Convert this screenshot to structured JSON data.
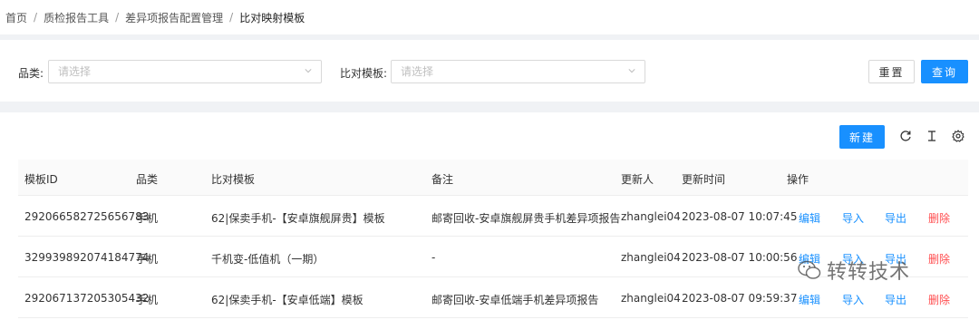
{
  "breadcrumb": [
    "首页",
    "质检报告工具",
    "差异项报告配置管理",
    "比对映射模板"
  ],
  "filters": {
    "category_label": "品类:",
    "category_placeholder": "请选择",
    "template_label": "比对模板:",
    "template_placeholder": "请选择",
    "reset_label": "重置",
    "query_label": "查询"
  },
  "toolbar": {
    "new_label": "新建",
    "icons": [
      "reload-icon",
      "column-height-icon",
      "settings-icon"
    ]
  },
  "table": {
    "columns": [
      "模板ID",
      "品类",
      "比对模板",
      "备注",
      "更新人",
      "更新时间",
      "操作"
    ],
    "rows": [
      {
        "id": "292066582725656783",
        "category": "手机",
        "template": "62|保卖手机-【安卓旗舰屏贵】模板",
        "remark": "邮寄回收-安卓旗舰屏贵手机差异项报告",
        "updater": "zhanglei04",
        "updated_at": "2023-08-07 10:07:45"
      },
      {
        "id": "329939892074184774",
        "category": "手机",
        "template": "千机变-低值机（一期）",
        "remark": "-",
        "updater": "zhanglei04",
        "updated_at": "2023-08-07 10:00:56"
      },
      {
        "id": "292067137205305432",
        "category": "手机",
        "template": "62|保卖手机-【安卓低端】模板",
        "remark": "邮寄回收-安卓低端手机差异项报告",
        "updater": "zhanglei04",
        "updated_at": "2023-08-07 09:59:37"
      }
    ],
    "actions": {
      "edit": "编辑",
      "import": "导入",
      "export": "导出",
      "delete": "删除"
    }
  },
  "watermark": "转转技术",
  "colors": {
    "primary": "#1890ff",
    "danger": "#ff4d4f",
    "background": "#f0f2f5"
  }
}
